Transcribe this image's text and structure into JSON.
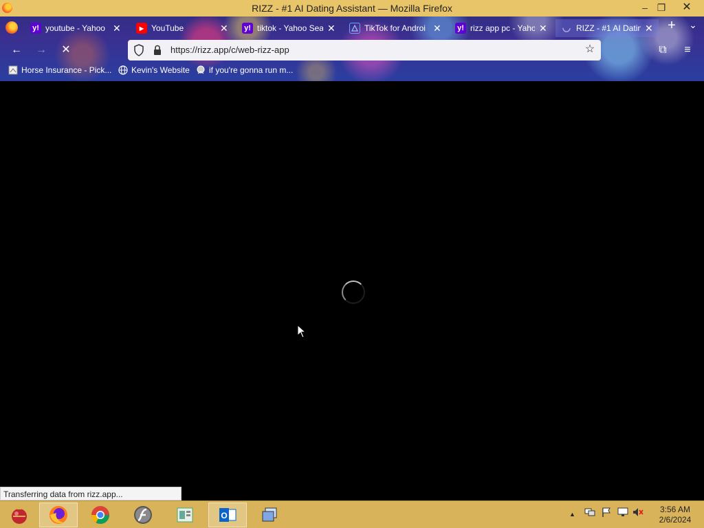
{
  "window": {
    "title": "RIZZ - #1 AI Dating Assistant — Mozilla Firefox",
    "controls": {
      "minimize": "–",
      "restore": "❐",
      "close": "✕"
    }
  },
  "tabs": [
    {
      "label": "youtube - Yahoo",
      "icon": "yahoo-icon",
      "icon_glyph": "y!",
      "close": "✕"
    },
    {
      "label": "YouTube",
      "icon": "youtube-icon",
      "icon_glyph": "▶",
      "close": "✕"
    },
    {
      "label": "tiktok - Yahoo Sear",
      "icon": "yahoo-icon",
      "icon_glyph": "y!",
      "close": "✕"
    },
    {
      "label": "TikTok for Androi",
      "icon": "tiktok-icon",
      "icon_glyph": "",
      "close": "✕"
    },
    {
      "label": "rizz app pc - Yaho",
      "icon": "yahoo-icon",
      "icon_glyph": "y!",
      "close": "✕"
    },
    {
      "label": "RIZZ - #1 AI Dating",
      "icon": "loading-icon",
      "icon_glyph": "",
      "close": "✕",
      "active": true
    }
  ],
  "tabstrip": {
    "new_tab": "+",
    "list_all": "⌄"
  },
  "navbar": {
    "back": "←",
    "forward": "→",
    "stop": "✕",
    "url": "https://rizz.app/c/web-rizz-app",
    "bookmark_star": "☆",
    "extensions": "⧉",
    "menu": "≡"
  },
  "bookmarks": [
    {
      "label": "Horse Insurance - Pick...",
      "icon": "page-icon"
    },
    {
      "label": "Kevin's Website",
      "icon": "globe-icon"
    },
    {
      "label": "if you're gonna run m...",
      "icon": "badge-icon"
    }
  ],
  "status": {
    "text": "Transferring data from rizz.app..."
  },
  "taskbar": {
    "apps": [
      "ornament-icon",
      "firefox-icon",
      "chrome-icon",
      "flash-icon",
      "files-icon",
      "outlook-icon",
      "windows-icon"
    ],
    "tray": {
      "chevron": "▲"
    },
    "clock": {
      "time": "3:56 AM",
      "date": "2/6/2024"
    }
  },
  "colors": {
    "titlebar": "#e9c56a",
    "taskbar": "#d8b35a",
    "yahoo": "#5f01d1",
    "youtube": "#ff0000",
    "content_bg": "#000000"
  }
}
